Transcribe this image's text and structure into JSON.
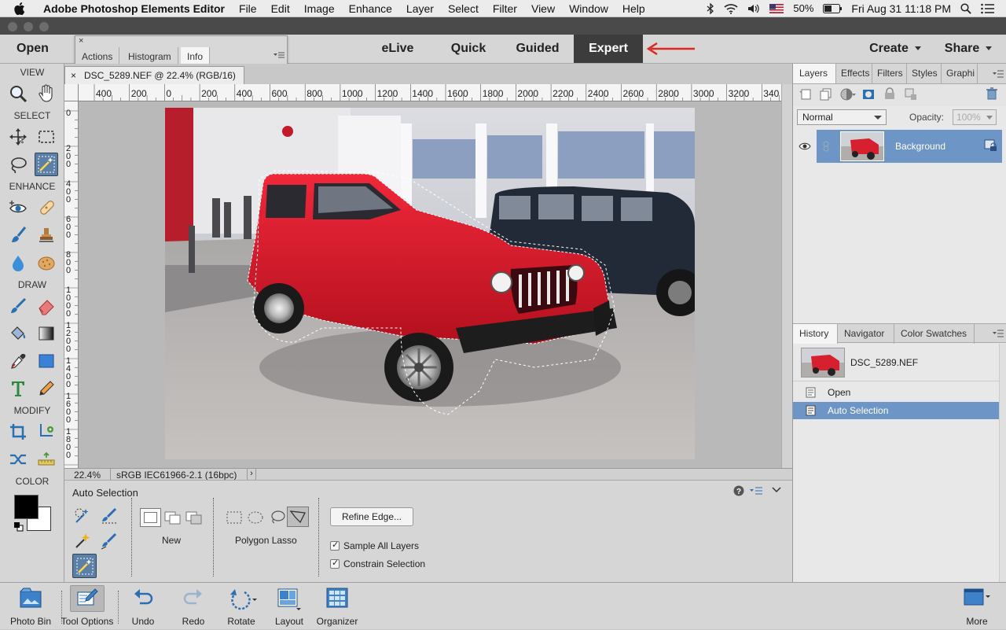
{
  "menubar": {
    "app_name": "Adobe Photoshop Elements Editor",
    "items": [
      "File",
      "Edit",
      "Image",
      "Enhance",
      "Layer",
      "Select",
      "Filter",
      "View",
      "Window",
      "Help"
    ],
    "battery": "50%",
    "clock": "Fri Aug 31  11:18 PM"
  },
  "modebar": {
    "open_label": "Open",
    "modes": [
      "eLive",
      "Quick",
      "Guided",
      "Expert"
    ],
    "active_mode": "Expert",
    "create_label": "Create",
    "share_label": "Share",
    "annotation_color": "#e0281e"
  },
  "info_panel": {
    "tabs": [
      "Actions",
      "Histogram",
      "Info"
    ],
    "active_tab": "Info"
  },
  "toolbox": {
    "sections": {
      "view": "VIEW",
      "select": "SELECT",
      "enhance": "ENHANCE",
      "draw": "DRAW",
      "modify": "MODIFY",
      "color": "COLOR"
    },
    "foreground_color": "#000000",
    "background_color": "#ffffff"
  },
  "document": {
    "tab_title": "DSC_5289.NEF @ 22.4% (RGB/16)",
    "ruler_top": [
      "400",
      "200",
      "0",
      "200",
      "400",
      "600",
      "800",
      "1000",
      "1200",
      "1400",
      "1600",
      "1800",
      "2000",
      "2200",
      "2400",
      "2600",
      "2800",
      "3000",
      "3200",
      "340"
    ],
    "ruler_left": [
      "0",
      "200",
      "400",
      "600",
      "800",
      "1000",
      "1200",
      "1400",
      "1600",
      "1800"
    ],
    "zoom": "22.4%",
    "profile": "sRGB IEC61966-2.1 (16bpc)"
  },
  "tool_options": {
    "title": "Auto Selection",
    "mode_label": "New",
    "lasso_label": "Polygon Lasso",
    "refine_button": "Refine Edge...",
    "sample_all_layers": "Sample All Layers",
    "constrain_selection": "Constrain Selection"
  },
  "layers_panel": {
    "tabs": [
      "Layers",
      "Effects",
      "Filters",
      "Styles",
      "Graphi"
    ],
    "active_tab": "Layers",
    "blend_mode": "Normal",
    "opacity_label": "Opacity:",
    "opacity_value": "100%",
    "layer_name": "Background"
  },
  "history_panel": {
    "tabs": [
      "History",
      "Navigator",
      "Color Swatches"
    ],
    "active_tab": "History",
    "snapshot": "DSC_5289.NEF",
    "states": [
      "Open",
      "Auto Selection"
    ],
    "selected_state": "Auto Selection"
  },
  "bottombar": {
    "items": [
      "Photo Bin",
      "Tool Options",
      "Undo",
      "Redo",
      "Rotate",
      "Layout",
      "Organizer"
    ],
    "more": "More"
  }
}
